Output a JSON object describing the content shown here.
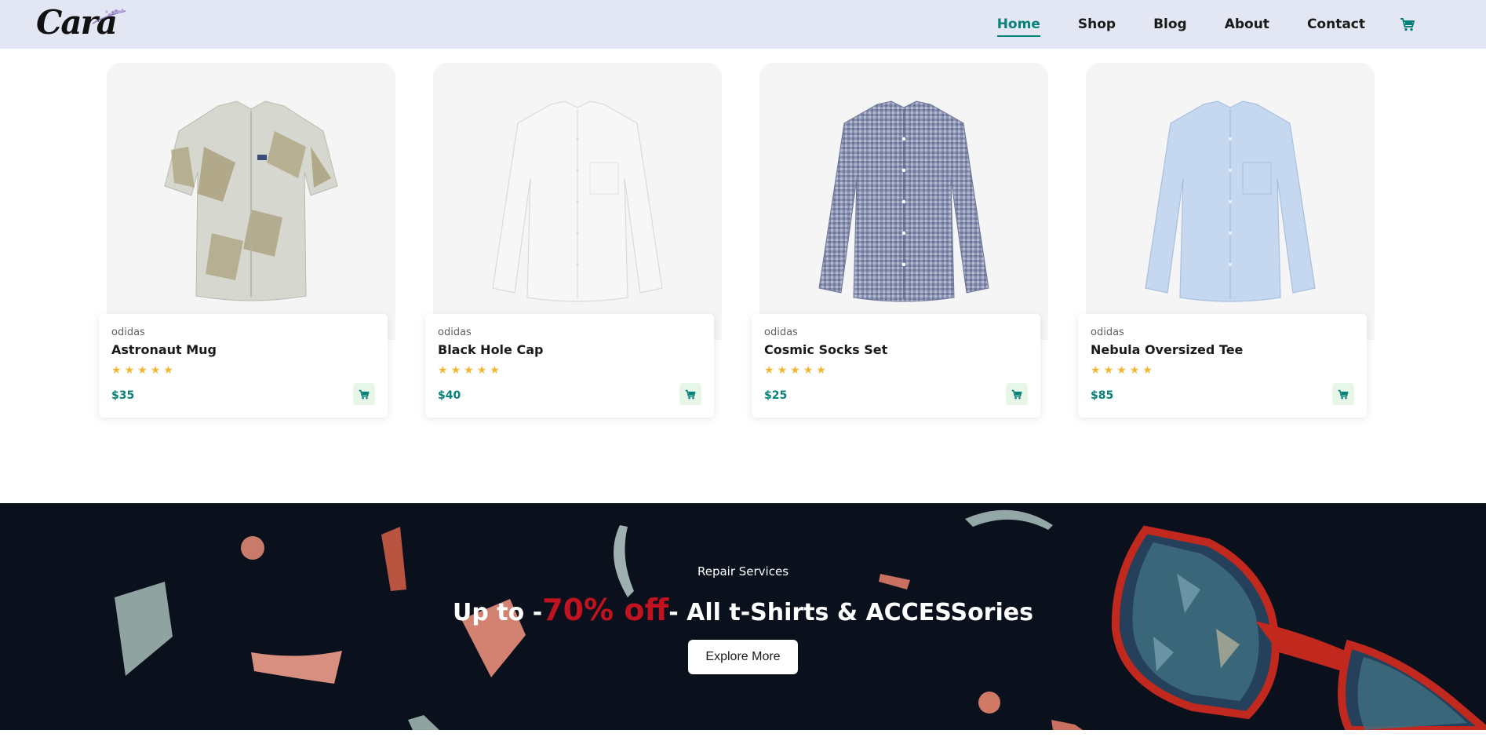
{
  "header": {
    "logo_text": "Cara",
    "nav": [
      {
        "label": "Home",
        "active": true
      },
      {
        "label": "Shop",
        "active": false
      },
      {
        "label": "Blog",
        "active": false
      },
      {
        "label": "About",
        "active": false
      },
      {
        "label": "Contact",
        "active": false
      }
    ],
    "cart_icon": "cart-icon"
  },
  "products": [
    {
      "brand": "odidas",
      "name": "Astronaut Mug",
      "rating": 5,
      "price": "$35",
      "image": "patterned-short-sleeve-shirt"
    },
    {
      "brand": "odidas",
      "name": "Black Hole Cap",
      "rating": 5,
      "price": "$40",
      "image": "white-long-sleeve-shirt"
    },
    {
      "brand": "odidas",
      "name": "Cosmic Socks Set",
      "rating": 5,
      "price": "$25",
      "image": "gingham-long-sleeve-shirt"
    },
    {
      "brand": "odidas",
      "name": "Nebula Oversized Tee",
      "rating": 5,
      "price": "$85",
      "image": "light-blue-long-sleeve-shirt"
    }
  ],
  "banner": {
    "subtitle": "Repair Services",
    "title_prefix": "Up to -",
    "title_highlight": "70% off",
    "title_suffix": "- All t-Shirts & ACCESSories",
    "button_label": "Explore More"
  },
  "colors": {
    "header_bg": "#e3e6f3",
    "accent": "#088178",
    "banner_bg": "#0a101c",
    "highlight": "#c1121f",
    "star": "#f3b632"
  }
}
